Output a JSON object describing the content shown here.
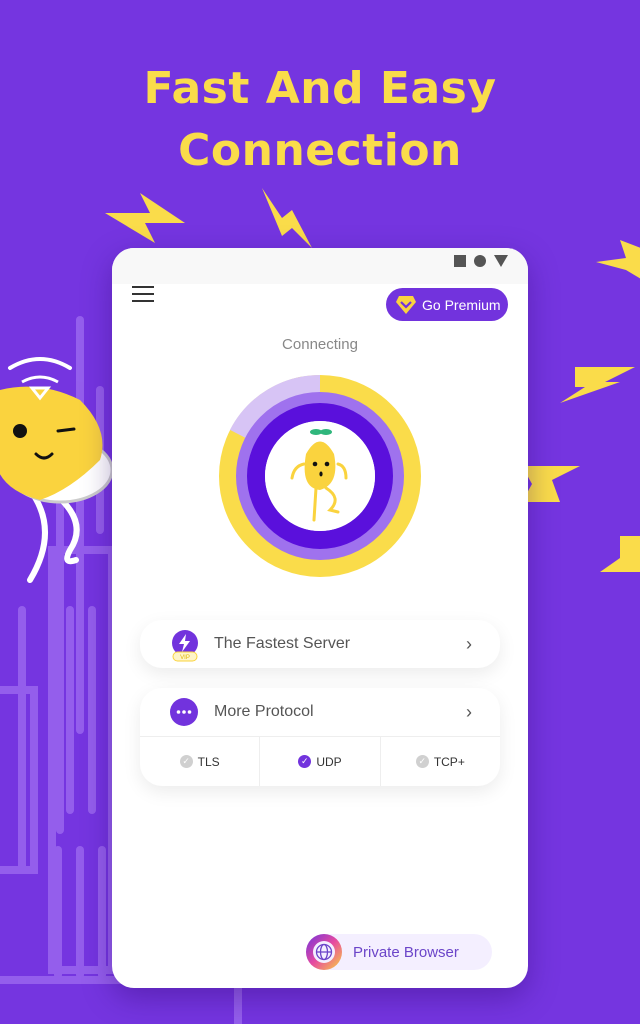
{
  "headline": {
    "line1": "Fast And Easy",
    "line2": "Connection"
  },
  "colors": {
    "background": "#7535e0",
    "accent_yellow": "#fadc4a",
    "primary_purple": "#7233dd"
  },
  "phone": {
    "status_icons": [
      "square-icon",
      "circle-icon",
      "triangle-icon"
    ],
    "menu_icon": "hamburger-icon",
    "premium_button": {
      "label": "Go Premium",
      "icon": "diamond-icon"
    },
    "connection_status": "Connecting",
    "server_card": {
      "label": "The Fastest Server",
      "icon": "lightning-vip-icon",
      "badge": "VIP"
    },
    "protocol_card": {
      "label": "More Protocol",
      "icon": "more-dots-icon",
      "options": [
        {
          "label": "TLS",
          "selected": false
        },
        {
          "label": "UDP",
          "selected": true
        },
        {
          "label": "TCP+",
          "selected": false
        }
      ]
    },
    "private_browser": {
      "label": "Private Browser",
      "icon": "globe-icon"
    }
  }
}
